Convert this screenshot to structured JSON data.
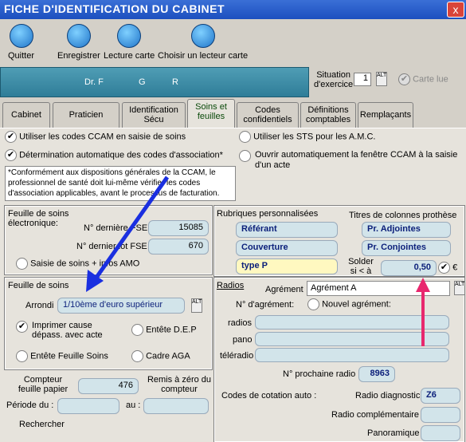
{
  "title": "FICHE D'IDENTIFICATION DU CABINET",
  "close": "x",
  "toolbar": {
    "quit": "Quitter",
    "save": "Enregistrer",
    "card": "Lecture carte",
    "reader": "Choisir un lecteur carte"
  },
  "banner": {
    "name1": "Dr. F",
    "name2": "G",
    "name3": "R"
  },
  "situation": {
    "label1": "Situation",
    "label2": "d'exercice",
    "value": "1",
    "spin": "ALT",
    "carte": "Carte lue"
  },
  "tabs": [
    "Cabinet",
    "Praticien",
    "Identification Sécu",
    "Soins et feuilles",
    "Codes confidentiels",
    "Définitions comptables",
    "Remplaçants"
  ],
  "options": {
    "ccam": "Utiliser les codes CCAM en saisie de soins",
    "assoc": "Détermination automatique des codes d'association*",
    "note": "*Conformément aux dispositions générales de la CCAM, le professionnel de santé doit lui-même vérifier les codes d'association applicables, avant le processus de facturation.",
    "sts": "Utiliser les STS pour les A.M.C.",
    "ouvrir": "Ouvrir automatiquement la fenêtre CCAM à la saisie d'un acte"
  },
  "fse": {
    "title1": "Feuille de soins",
    "title2": "électronique:",
    "last_fse_label": "N° dernière FSE",
    "last_fse": "15085",
    "last_lot_label": "N° dernier lot FSE",
    "last_lot": "670",
    "saisie": "Saisie de soins + infos AMO"
  },
  "feuille": {
    "title": "Feuille de soins",
    "arrondi_label": "Arrondi",
    "arrondi": "1/10ème d'euro supérieur",
    "spin": "ALT",
    "imprimer": "Imprimer cause dépass. avec acte",
    "entete_dep": "Entête D.E.P",
    "entete_fs": "Entête Feuille Soins",
    "cadre": "Cadre AGA",
    "compteur_label": "Compteur feuille papier",
    "compteur": "476",
    "remis": "Remis à zéro du compteur",
    "periode": "Période du :",
    "au": "au :",
    "rechercher": "Rechercher"
  },
  "rubriques": {
    "title": "Rubriques personnalisées",
    "titres": "Titres de colonnes prothèse",
    "r1": "Référant",
    "r2": "Couverture",
    "r3": "type P",
    "t1": "Pr. Adjointes",
    "t2": "Pr. Conjointes",
    "solder": "Solder si < à",
    "solder_val": "0,50",
    "euro": "€"
  },
  "radios": {
    "title": "Radios",
    "agrement_label": "Agrément",
    "agrement": "Agrément A",
    "spin": "ALT",
    "num_label": "N° d'agrément:",
    "nouvel": "Nouvel agrément:",
    "radios": "radios",
    "pano": "pano",
    "teleradio": "téléradio",
    "prochaine_label": "N° prochaine radio",
    "prochaine": "8963",
    "codes_label": "Codes de cotation auto :",
    "diag_label": "Radio diagnostic",
    "diag": "Z6",
    "comp_label": "Radio complémentaire",
    "pano_label": "Panoramique"
  },
  "colors": {
    "titlebar": "#1c4fbf",
    "field": "#d2e4ea",
    "arrow_blue": "#1a2fe0",
    "arrow_pink": "#e8286e"
  }
}
